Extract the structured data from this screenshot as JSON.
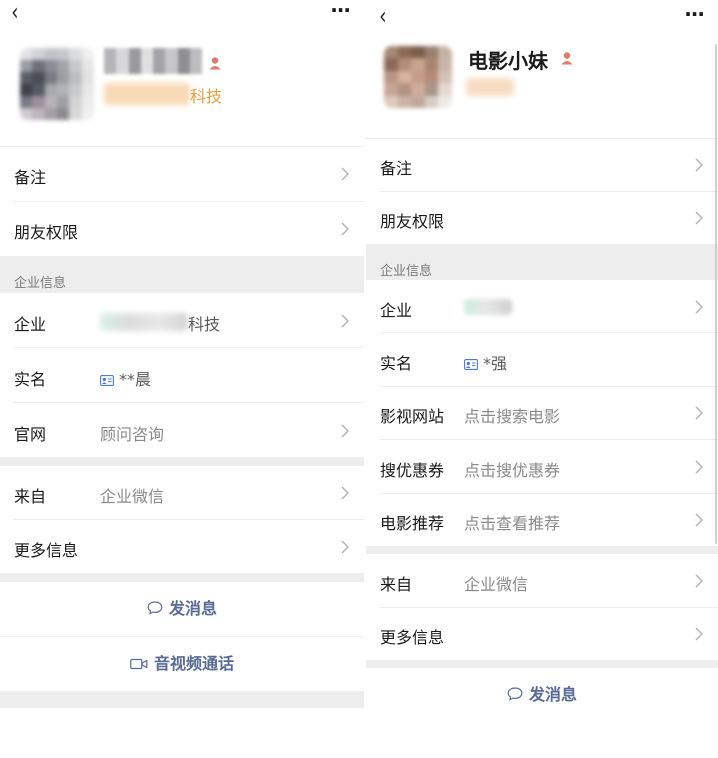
{
  "left": {
    "header": {
      "back_glyph": "‹",
      "more_glyph": "···"
    },
    "profile": {
      "company_suffix": "科技"
    },
    "items": {
      "remark_label": "备注",
      "permission_label": "朋友权限"
    },
    "section_title": "企业信息",
    "enterprise": {
      "company_label": "企业",
      "company_suffix": "科技",
      "realname_label": "实名",
      "realname_value": "**晨",
      "website_label": "官网",
      "website_value": "顾问咨询"
    },
    "source": {
      "from_label": "来自",
      "from_value": "企业微信",
      "more_label": "更多信息"
    },
    "actions": {
      "message_label": "发消息",
      "call_label": "音视频通话"
    }
  },
  "right": {
    "header": {
      "back_glyph": "‹",
      "more_glyph": "···"
    },
    "profile": {
      "name": "电影小妹"
    },
    "items": {
      "remark_label": "备注",
      "permission_label": "朋友权限"
    },
    "section_title": "企业信息",
    "enterprise": {
      "company_label": "企业",
      "realname_label": "实名",
      "realname_value": "*强",
      "film_site_label": "影视网站",
      "film_site_value": "点击搜索电影",
      "coupon_label": "搜优惠券",
      "coupon_value": "点击搜优惠券",
      "recommend_label": "电影推荐",
      "recommend_value": "点击查看推荐"
    },
    "source": {
      "from_label": "来自",
      "from_value": "企业微信",
      "more_label": "更多信息"
    },
    "actions": {
      "message_label": "发消息"
    }
  },
  "colors": {
    "accent_link": "#576b95",
    "orange_company": "#e9a13c",
    "person_icon": "#e07a6a",
    "separator": "#ededed",
    "card_icon": "#4a7cc9"
  },
  "icons": {
    "back": "chevron-left-icon",
    "more": "more-dots-icon",
    "person": "person-icon",
    "chevron": "chevron-right-icon",
    "id_card": "id-card-icon",
    "chat": "chat-bubble-icon",
    "video": "video-camera-icon"
  }
}
